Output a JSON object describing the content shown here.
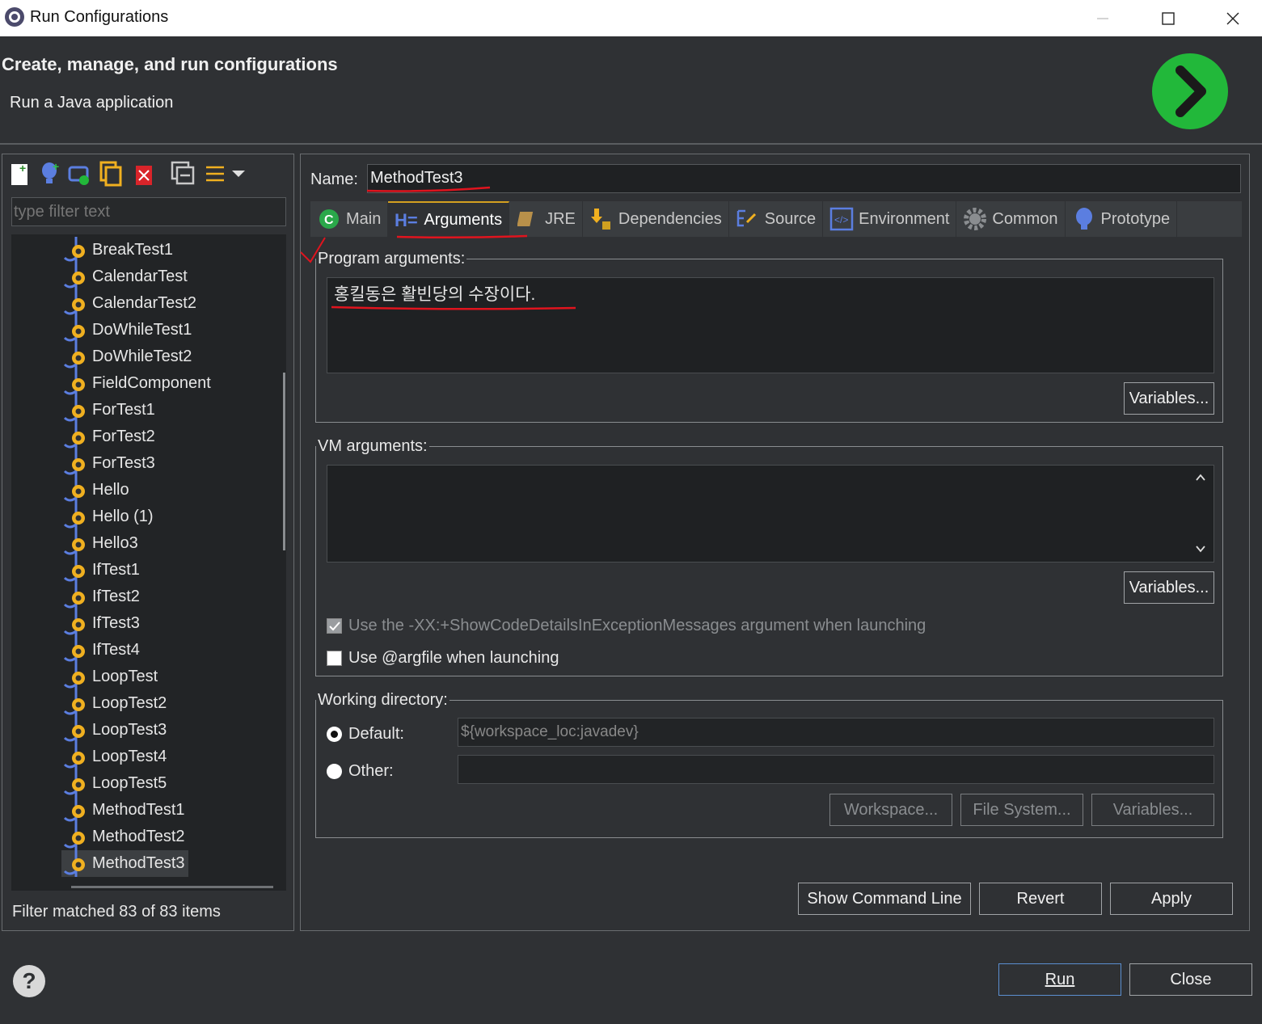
{
  "window": {
    "title": "Run Configurations"
  },
  "header": {
    "title": "Create, manage, and run configurations",
    "subtitle": "Run a Java application"
  },
  "left": {
    "filter_placeholder": "type filter text",
    "items": [
      "BreakTest1",
      "CalendarTest",
      "CalendarTest2",
      "DoWhileTest1",
      "DoWhileTest2",
      "FieldComponent",
      "ForTest1",
      "ForTest2",
      "ForTest3",
      "Hello",
      "Hello (1)",
      "Hello3",
      "IfTest1",
      "IfTest2",
      "IfTest3",
      "IfTest4",
      "LoopTest",
      "LoopTest2",
      "LoopTest3",
      "LoopTest4",
      "LoopTest5",
      "MethodTest1",
      "MethodTest2",
      "MethodTest3"
    ],
    "selected": "MethodTest3",
    "status": "Filter matched 83 of 83 items"
  },
  "config": {
    "name_label": "Name:",
    "name_value": "MethodTest3",
    "tabs": [
      "Main",
      "Arguments",
      "JRE",
      "Dependencies",
      "Source",
      "Environment",
      "Common",
      "Prototype"
    ],
    "active_tab": "Arguments",
    "program_args_label": "Program arguments:",
    "program_args_value": "홍킬동은 활빈당의 수장이다.",
    "variables_label": "Variables...",
    "vm_args_label": "VM arguments:",
    "vm_args_value": "",
    "show_code_details": "Use the -XX:+ShowCodeDetailsInExceptionMessages argument when launching",
    "argfile": "Use @argfile when launching",
    "working_dir_label": "Working directory:",
    "default_label": "Default:",
    "default_value": "${workspace_loc:javadev}",
    "other_label": "Other:",
    "other_value": "",
    "workspace_btn": "Workspace...",
    "filesystem_btn": "File System...",
    "variables_btn": "Variables..."
  },
  "actions": {
    "show_cmd": "Show Command Line",
    "revert": "Revert",
    "apply": "Apply",
    "run": "Run",
    "close": "Close"
  },
  "colors": {
    "accent_run": "#22b83a",
    "annotation": "#e0141e",
    "background": "#2f3134"
  }
}
